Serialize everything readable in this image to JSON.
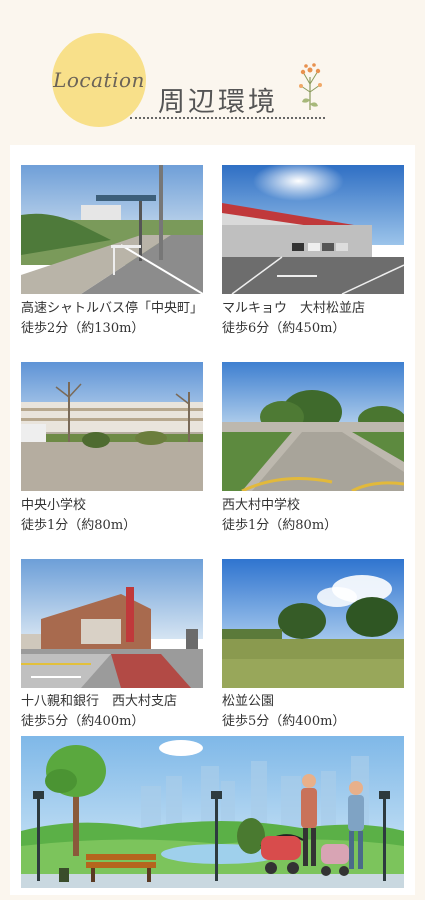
{
  "header": {
    "badge": "Location",
    "title": "周辺環境"
  },
  "places": [
    {
      "name": "高速シャトルバス停「中央町」",
      "distance": "徒歩2分（約130m）",
      "photo": "bus-stop-photo"
    },
    {
      "name": "マルキョウ　大村松並店",
      "distance": "徒歩6分（約450m）",
      "photo": "supermarket-photo"
    },
    {
      "name": "中央小学校",
      "distance": "徒歩1分（約80m）",
      "photo": "elementary-school-photo"
    },
    {
      "name": "西大村中学校",
      "distance": "徒歩1分（約80m）",
      "photo": "junior-high-school-photo"
    },
    {
      "name": "十八親和銀行　西大村支店",
      "distance": "徒歩5分（約400m）",
      "photo": "bank-photo"
    },
    {
      "name": "松並公園",
      "distance": "徒歩5分（約400m）",
      "photo": "park-photo"
    }
  ],
  "colors": {
    "badge": "#f8e08a",
    "background": "#fbf6ee",
    "card": "#ffffff"
  }
}
